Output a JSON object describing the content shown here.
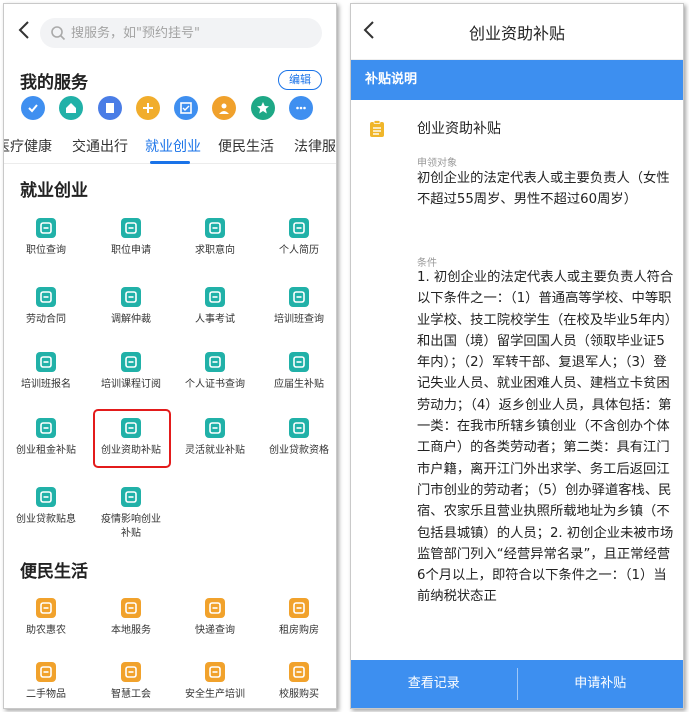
{
  "left": {
    "search_placeholder": "搜服务，如\"预约挂号\"",
    "my_services_title": "我的服务",
    "edit_label": "编辑",
    "shortcut_icons": [
      {
        "icon": "check-icon",
        "color": "#3f8ff0"
      },
      {
        "icon": "home-icon",
        "color": "#21b1a8"
      },
      {
        "icon": "document-icon",
        "color": "#4a7de6"
      },
      {
        "icon": "plus-icon",
        "color": "#f1ad2c"
      },
      {
        "icon": "checklist-icon",
        "color": "#3f8ff0"
      },
      {
        "icon": "person-icon",
        "color": "#f0a12c"
      },
      {
        "icon": "star-icon",
        "color": "#1ea886"
      },
      {
        "icon": "more-icon",
        "color": "#3f8ff0"
      }
    ],
    "tabs": [
      "医疗健康",
      "交通出行",
      "就业创业",
      "便民生活",
      "法律服务"
    ],
    "active_tab": "就业创业",
    "section_employment": "就业创业",
    "employment_items": [
      {
        "label": "职位查询",
        "icon": "job-icon",
        "color": "#21b1a8"
      },
      {
        "label": "职位申请",
        "icon": "info-icon",
        "color": "#21b1a8"
      },
      {
        "label": "求职意向",
        "icon": "briefcase-icon",
        "color": "#21b1a8"
      },
      {
        "label": "个人简历",
        "icon": "resume-icon",
        "color": "#21b1a8"
      },
      {
        "label": "劳动合同",
        "icon": "contract-icon",
        "color": "#21b1a8"
      },
      {
        "label": "调解仲裁",
        "icon": "gavel-icon",
        "color": "#21b1a8"
      },
      {
        "label": "人事考试",
        "icon": "exam-icon",
        "color": "#21b1a8"
      },
      {
        "label": "培训班查询",
        "icon": "training-icon",
        "color": "#21b1a8"
      },
      {
        "label": "培训班报名",
        "icon": "signup-icon",
        "color": "#21b1a8"
      },
      {
        "label": "培训课程订阅",
        "icon": "course-icon",
        "color": "#21b1a8"
      },
      {
        "label": "个人证书查询",
        "icon": "certificate-icon",
        "color": "#21b1a8"
      },
      {
        "label": "应届生补贴",
        "icon": "graduate-icon",
        "color": "#21b1a8"
      },
      {
        "label": "创业租金补贴",
        "icon": "rent-icon",
        "color": "#21b1a8"
      },
      {
        "label": "创业资助补贴",
        "icon": "subsidy-icon",
        "color": "#21b1a8"
      },
      {
        "label": "灵活就业补贴",
        "icon": "flexible-icon",
        "color": "#21b1a8"
      },
      {
        "label": "创业贷款资格",
        "icon": "loan-check-icon",
        "color": "#21b1a8"
      },
      {
        "label": "创业贷款贴息",
        "icon": "interest-icon",
        "color": "#21b1a8"
      },
      {
        "label": "疫情影响创业补贴",
        "icon": "epidemic-icon",
        "color": "#21b1a8"
      }
    ],
    "section_life": "便民生活",
    "life_items": [
      {
        "label": "助农惠农",
        "icon": "fruit-icon",
        "color": "#f1a22c"
      },
      {
        "label": "本地服务",
        "icon": "handshake-icon",
        "color": "#f1a22c"
      },
      {
        "label": "快递查询",
        "icon": "truck-icon",
        "color": "#f1a22c"
      },
      {
        "label": "租房购房",
        "icon": "house-icon",
        "color": "#f1a22c"
      },
      {
        "label": "二手物品",
        "icon": "bag-icon",
        "color": "#f1a22c"
      },
      {
        "label": "智慧工会",
        "icon": "badge-icon",
        "color": "#f1a22c"
      },
      {
        "label": "安全生产培训",
        "icon": "helmet-icon",
        "color": "#f1a22c"
      },
      {
        "label": "校服购买",
        "icon": "shirt-icon",
        "color": "#f1a22c"
      }
    ]
  },
  "right": {
    "title": "创业资助补贴",
    "section_bar": "补贴说明",
    "content_title": "创业资助补贴",
    "applicant_label": "申领对象",
    "applicant_text": "初创企业的法定代表人或主要负责人（女性不超过55周岁、男性不超过60周岁）",
    "conditions_label": "条件",
    "conditions_text": "1. 初创企业的法定代表人或主要负责人符合以下条件之一：（1）普通高等学校、中等职业学校、技工院校学生（在校及毕业5年内）和出国（境）留学回国人员（领取毕业证5年内）；（2）军转干部、复退军人；（3）登记失业人员、就业困难人员、建档立卡贫困劳动力；（4）返乡创业人员，具体包括：第一类：在我市所辖乡镇创业（不含创办个体工商户）的各类劳动者；第二类：具有江门市户籍，离开江门外出求学、务工后返回江门市创业的劳动者；（5）创办驿道客栈、民宿、农家乐且营业执照所载地址为乡镇（不包括县城镇）的人员；2. 初创企业未被市场监管部门列入“经营异常名录”，且正常经营6个月以上，即符合以下条件之一：（1）当前纳税状态正",
    "btn_records": "查看记录",
    "btn_apply": "申请补贴",
    "accent": "#3d8ff0"
  }
}
